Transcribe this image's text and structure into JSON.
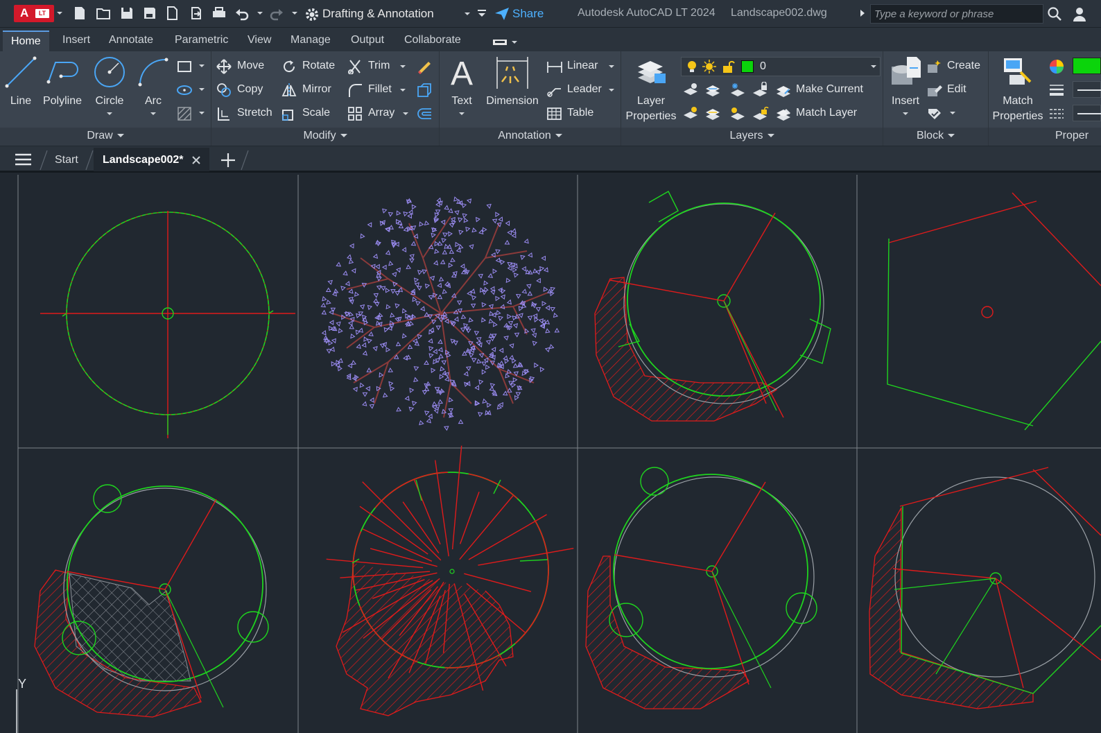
{
  "titlebar": {
    "app_badge": "A",
    "app_badge_sub": "LT",
    "workspace": "Drafting & Annotation",
    "share": "Share",
    "app_title": "Autodesk AutoCAD LT 2024",
    "doc_title": "Landscape002.dwg",
    "search_placeholder": "Type a keyword or phrase"
  },
  "ribbon_tabs": [
    "Home",
    "Insert",
    "Annotate",
    "Parametric",
    "View",
    "Manage",
    "Output",
    "Collaborate"
  ],
  "ribbon": {
    "draw": {
      "title": "Draw",
      "line": "Line",
      "polyline": "Polyline",
      "circle": "Circle",
      "arc": "Arc"
    },
    "modify": {
      "title": "Modify",
      "move": "Move",
      "rotate": "Rotate",
      "trim": "Trim",
      "copy": "Copy",
      "mirror": "Mirror",
      "fillet": "Fillet",
      "stretch": "Stretch",
      "scale": "Scale",
      "array": "Array"
    },
    "annotation": {
      "title": "Annotation",
      "text": "Text",
      "dimension": "Dimension",
      "linear": "Linear",
      "leader": "Leader",
      "table": "Table"
    },
    "layers": {
      "title": "Layers",
      "layer_properties_1": "Layer",
      "layer_properties_2": "Properties",
      "current_layer": "0",
      "make_current": "Make Current",
      "match_layer": "Match Layer"
    },
    "block": {
      "title": "Block",
      "insert": "Insert",
      "create": "Create",
      "edit": "Edit"
    },
    "properties": {
      "title": "Proper",
      "match_1": "Match",
      "match_2": "Properties"
    }
  },
  "doc_tabs": {
    "start": "Start",
    "active": "Landscape002*"
  },
  "canvas": {
    "ucs_label": "Y",
    "colors": {
      "background": "#212830",
      "grid": "#8a8f96",
      "red": "#e01b1b",
      "green": "#1fd41f",
      "gray": "#9aa0a6",
      "purple": "#9b8cf2",
      "brown": "#8a3a3a"
    }
  }
}
